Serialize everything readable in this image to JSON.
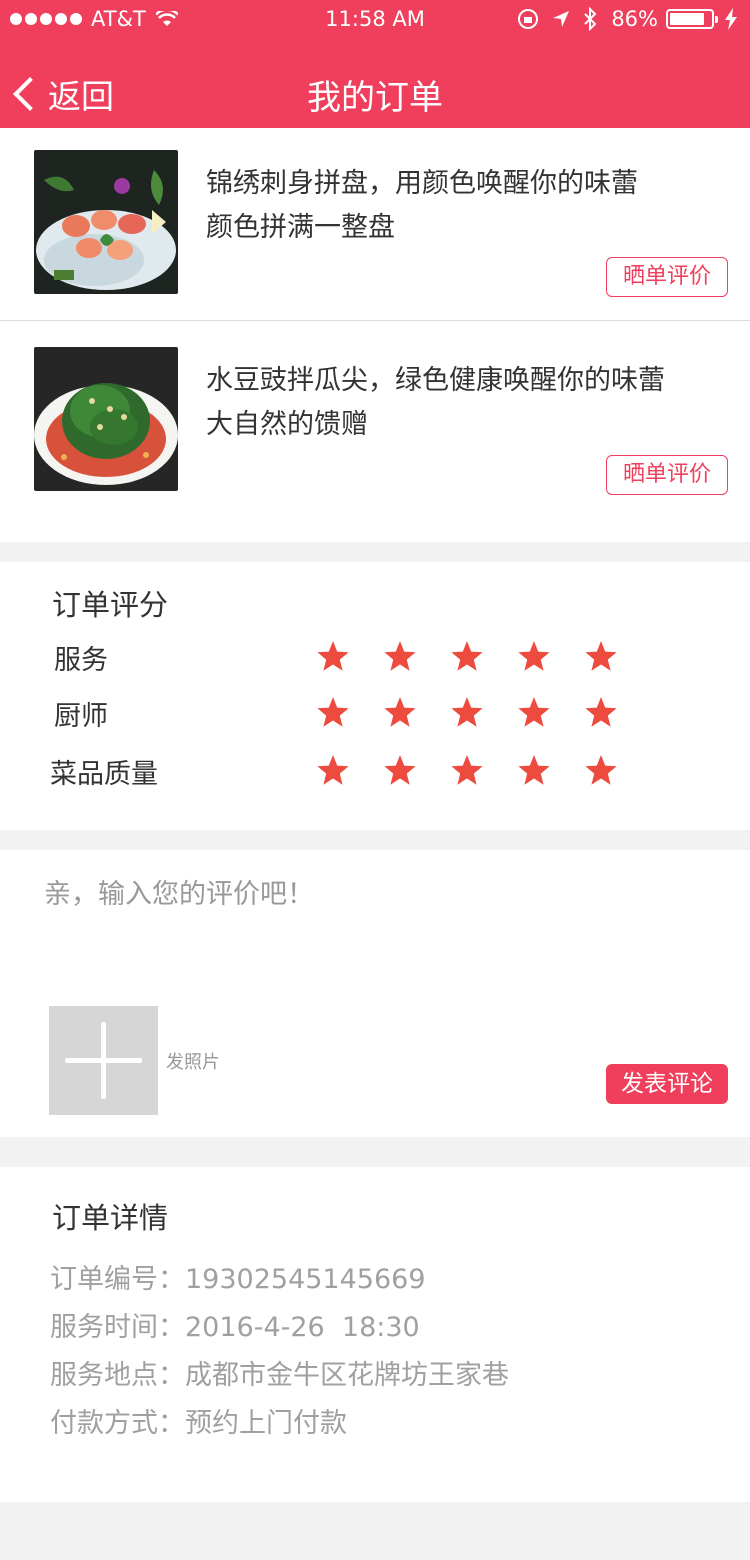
{
  "status_bar": {
    "carrier": "AT&T",
    "time": "11:58 AM",
    "battery": "86%",
    "battery_level": 0.86
  },
  "nav": {
    "back_label": "返回",
    "title": "我的订单"
  },
  "products": [
    {
      "title_line1": "锦绣刺身拼盘，用颜色唤醒你的味蕾",
      "title_line2": "颜色拼满一整盘",
      "review_label": "晒单评价",
      "image": "sashimi-platter-photo"
    },
    {
      "title_line1": "水豆豉拌瓜尖，绿色健康唤醒你的味蕾",
      "title_line2": "大自然的馈赠",
      "review_label": "晒单评价",
      "image": "green-vegetable-dish-photo"
    }
  ],
  "rating": {
    "title": "订单评分",
    "rows": [
      {
        "label": "服务",
        "stars": 5,
        "max": 5
      },
      {
        "label": "厨师",
        "stars": 5,
        "max": 5
      },
      {
        "label": "菜品质量",
        "stars": 5,
        "max": 5
      }
    ],
    "star_color": "#ee4b3f"
  },
  "comment": {
    "placeholder": "亲，输入您的评价吧！",
    "value": "",
    "photo_label": "发照片",
    "submit_label": "发表评论"
  },
  "details": {
    "title": "订单详情",
    "rows": [
      {
        "label": "订单编号：",
        "value": "19302545145669"
      },
      {
        "label": "服务时间：",
        "value": "2016-4-26  18:30"
      },
      {
        "label": "服务地点：",
        "value": "成都市金牛区花牌坊王家巷"
      },
      {
        "label": "付款方式：",
        "value": "预约上门付款"
      }
    ]
  },
  "colors": {
    "brand": "#ef3f5c",
    "page_bg": "#f2f2f2"
  }
}
